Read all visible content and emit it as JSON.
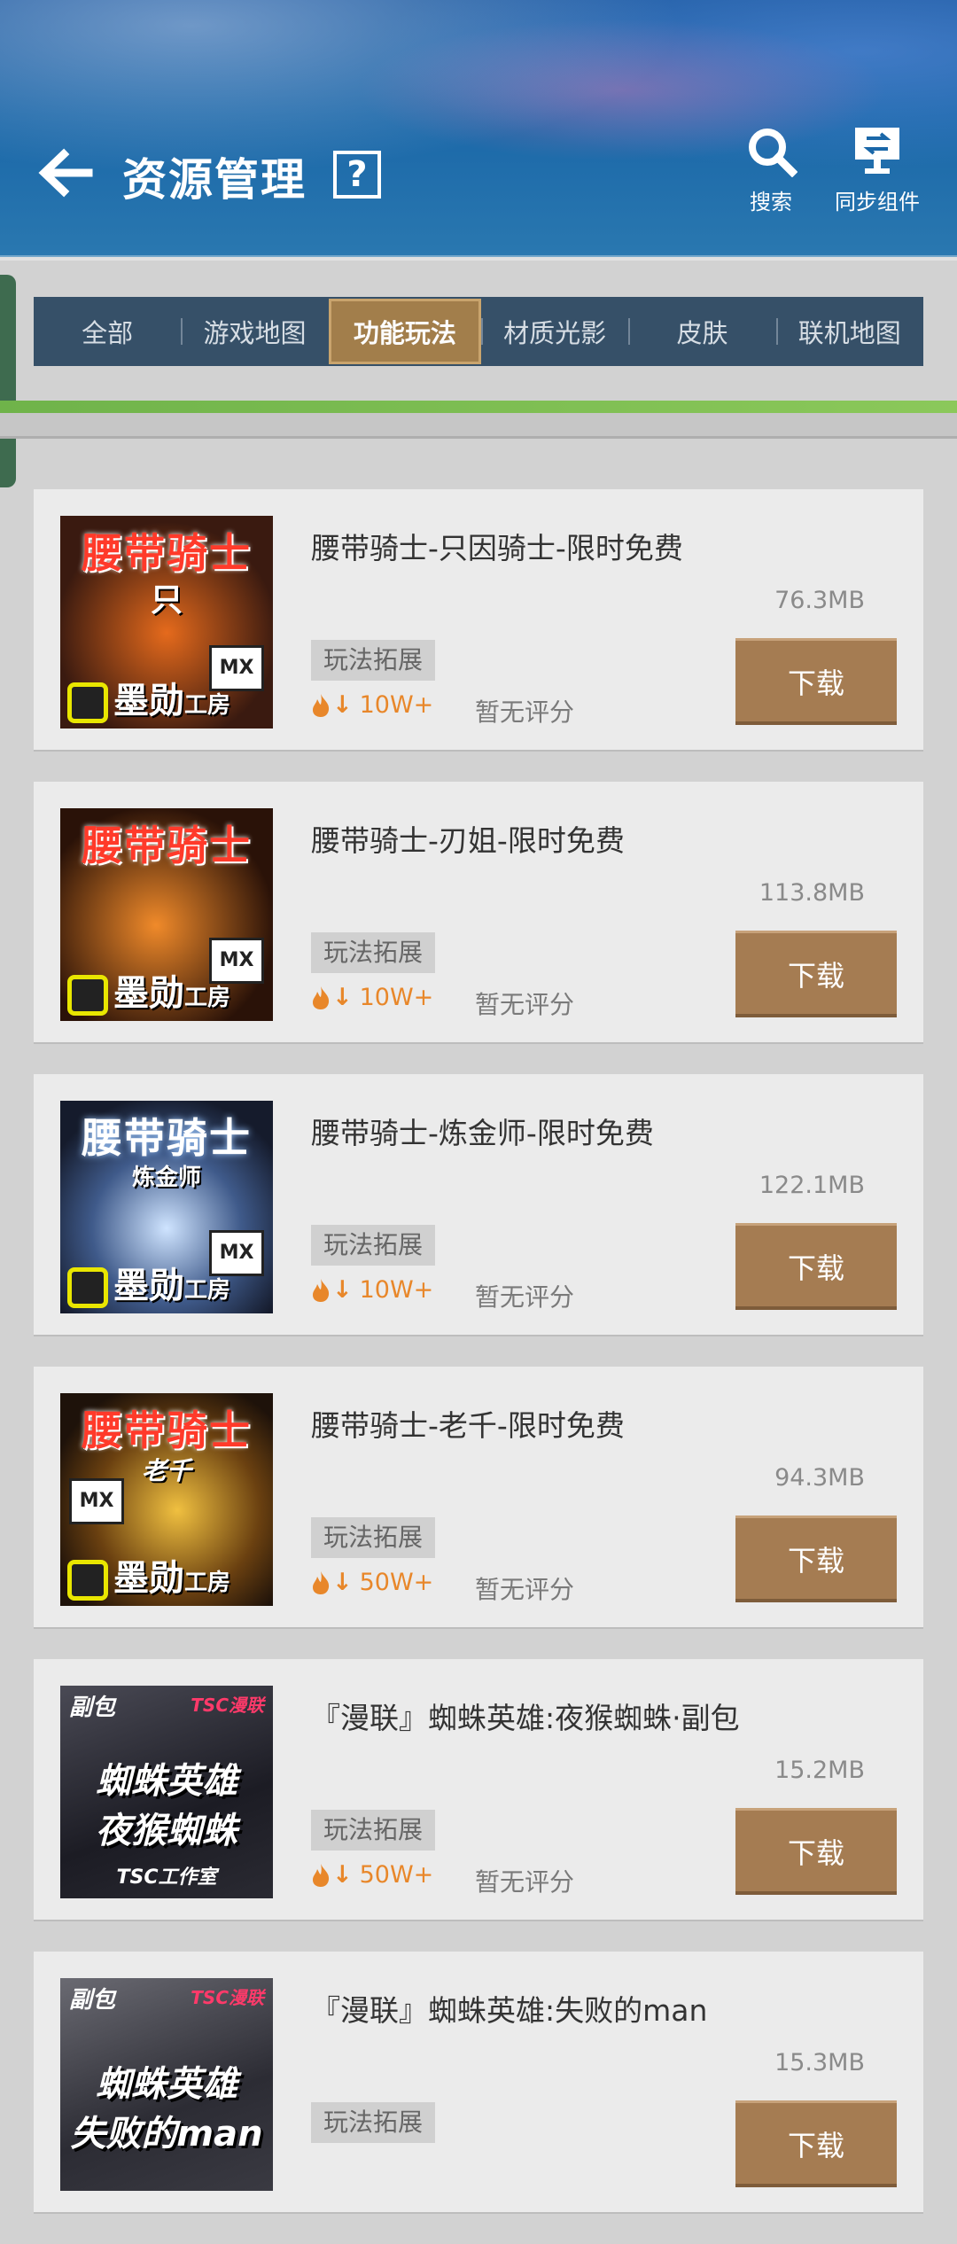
{
  "header": {
    "title": "资源管理",
    "help_label": "?",
    "search_label": "搜索",
    "sync_label": "同步组件"
  },
  "tabs": [
    {
      "label": "全部",
      "active": false
    },
    {
      "label": "游戏地图",
      "active": false
    },
    {
      "label": "功能玩法",
      "active": true
    },
    {
      "label": "材质光影",
      "active": false
    },
    {
      "label": "皮肤",
      "active": false
    },
    {
      "label": "联机地图",
      "active": false
    }
  ],
  "items": [
    {
      "name": "腰带骑士-只因骑士-限时免费",
      "size": "76.3MB",
      "tag": "玩法拓展",
      "downloads": "10W+",
      "rating": "暂无评分",
      "button": "下载",
      "thumb": {
        "title": "腰带骑士",
        "subtitle": "只",
        "badge": "MX",
        "studio": "墨勋",
        "studio_suffix": "工房"
      }
    },
    {
      "name": "腰带骑士-刃姐-限时免费",
      "size": "113.8MB",
      "tag": "玩法拓展",
      "downloads": "10W+",
      "rating": "暂无评分",
      "button": "下载",
      "thumb": {
        "title": "腰带骑士",
        "subtitle": "",
        "badge": "MX",
        "studio": "墨勋",
        "studio_suffix": "工房"
      }
    },
    {
      "name": "腰带骑士-炼金师-限时免费",
      "size": "122.1MB",
      "tag": "玩法拓展",
      "downloads": "10W+",
      "rating": "暂无评分",
      "button": "下载",
      "thumb": {
        "title": "腰带骑士",
        "subtitle": "炼金师",
        "badge": "MX",
        "studio": "墨勋",
        "studio_suffix": "工房"
      }
    },
    {
      "name": "腰带骑士-老千-限时免费",
      "size": "94.3MB",
      "tag": "玩法拓展",
      "downloads": "50W+",
      "rating": "暂无评分",
      "button": "下载",
      "thumb": {
        "title": "腰带骑士",
        "subtitle": "老千",
        "badge": "MX",
        "studio": "墨勋",
        "studio_suffix": "工房"
      }
    },
    {
      "name": "『漫联』蜘蛛英雄:夜猴蜘蛛·副包",
      "size": "15.2MB",
      "tag": "玩法拓展",
      "downloads": "50W+",
      "rating": "暂无评分",
      "button": "下载",
      "thumb": {
        "corner_left": "副包",
        "corner_right": "TSC漫联",
        "line1": "蜘蛛英雄",
        "line2": "夜猴蜘蛛",
        "footer": "TSC工作室"
      }
    },
    {
      "name": "『漫联』蜘蛛英雄:失败的man",
      "size": "15.3MB",
      "tag": "玩法拓展",
      "downloads": "",
      "rating": "",
      "button": "下载",
      "thumb": {
        "corner_left": "副包",
        "corner_right": "TSC漫联",
        "line1": "蜘蛛英雄",
        "line2": "失败的man",
        "footer": ""
      }
    }
  ],
  "colors": {
    "header_blue": "#1a67a8",
    "active_tab": "#a07a44",
    "download_button": "#a57c52",
    "heat": "#e8872a"
  }
}
